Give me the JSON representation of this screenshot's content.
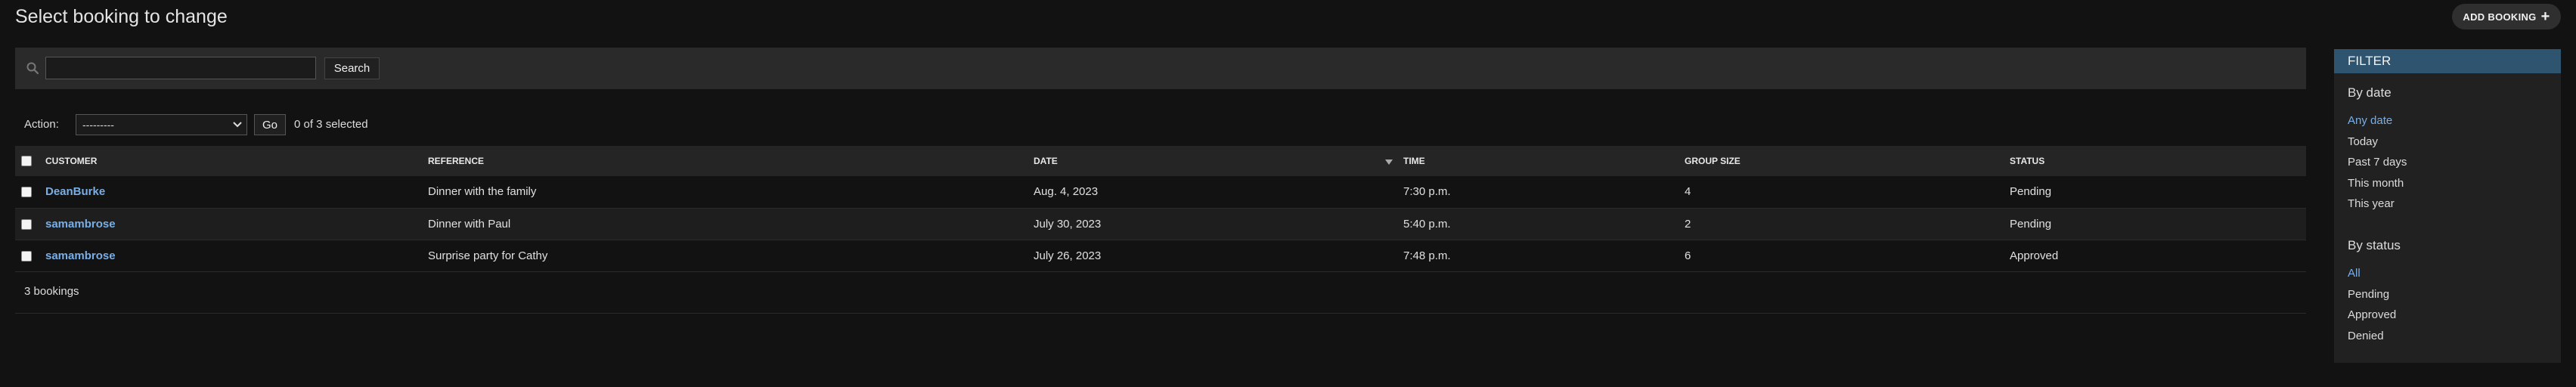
{
  "page": {
    "title": "Select booking to change",
    "add_button_label": "ADD BOOKING",
    "add_button_icon": "plus-icon"
  },
  "search": {
    "value": "",
    "placeholder": "",
    "button_label": "Search",
    "icon": "search-icon"
  },
  "actions": {
    "label": "Action:",
    "selected_option": "---------",
    "go_label": "Go",
    "selection_count": "0 of 3 selected"
  },
  "table": {
    "columns": [
      "CUSTOMER",
      "REFERENCE",
      "DATE",
      "TIME",
      "GROUP SIZE",
      "STATUS"
    ],
    "sorted_column": "DATE",
    "rows": [
      {
        "customer": "DeanBurke",
        "reference": "Dinner with the family",
        "date": "Aug. 4, 2023",
        "time": "7:30 p.m.",
        "group_size": "4",
        "status": "Pending"
      },
      {
        "customer": "samambrose",
        "reference": "Dinner with Paul",
        "date": "July 30, 2023",
        "time": "5:40 p.m.",
        "group_size": "2",
        "status": "Pending"
      },
      {
        "customer": "samambrose",
        "reference": "Surprise party for Cathy",
        "date": "July 26, 2023",
        "time": "7:48 p.m.",
        "group_size": "6",
        "status": "Approved"
      }
    ]
  },
  "paginator": {
    "text": "3 bookings"
  },
  "filter": {
    "title": "FILTER",
    "groups": [
      {
        "title": "By date",
        "items": [
          "Any date",
          "Today",
          "Past 7 days",
          "This month",
          "This year"
        ],
        "selected": "Any date"
      },
      {
        "title": "By status",
        "items": [
          "All",
          "Pending",
          "Approved",
          "Denied"
        ],
        "selected": "All"
      }
    ]
  },
  "colors": {
    "background": "#121212",
    "link": "#79aee6",
    "filter_header": "#2f5470",
    "toolbar": "#2a2a2a"
  }
}
